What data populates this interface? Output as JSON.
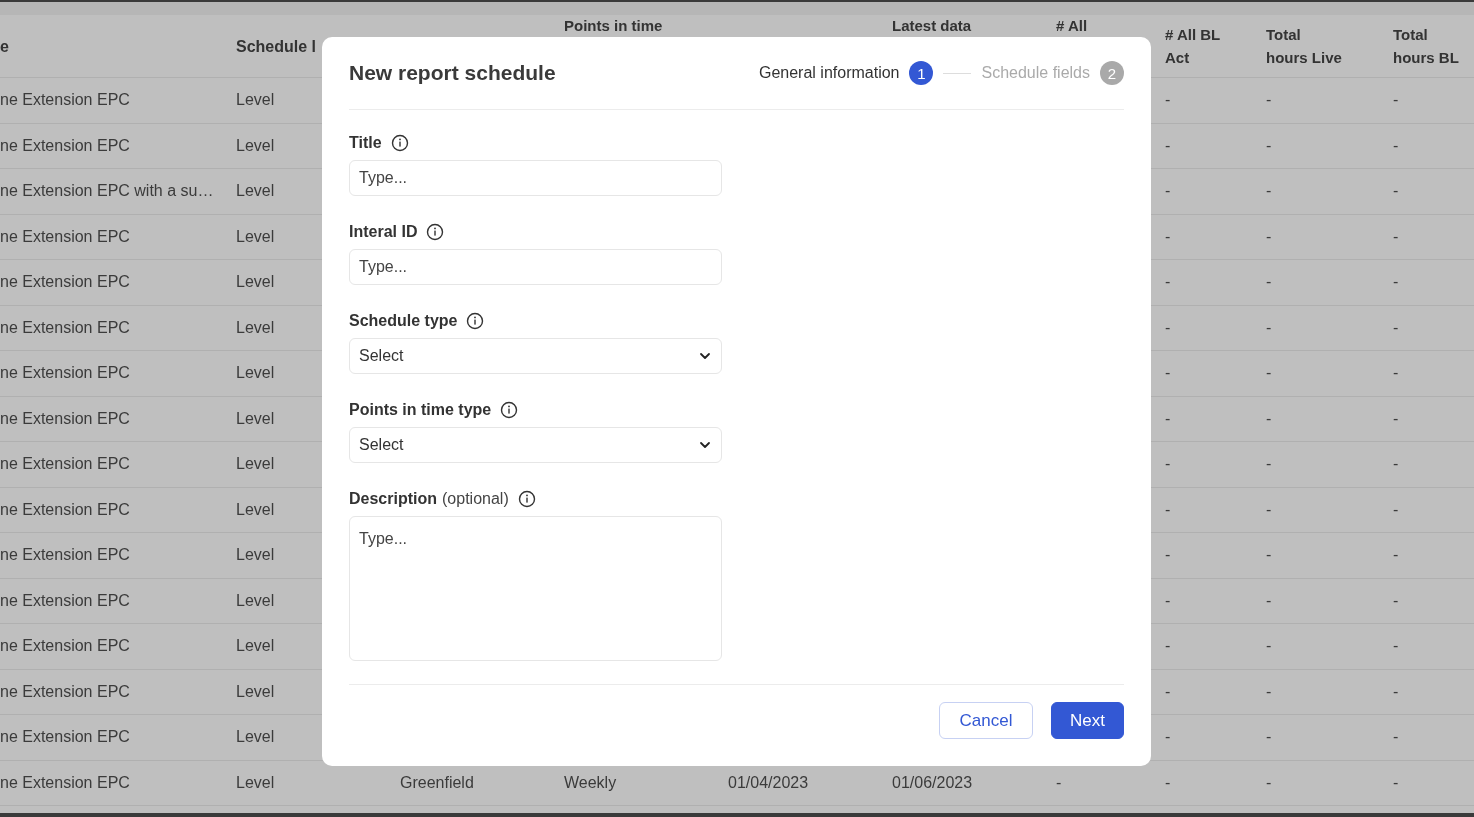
{
  "table": {
    "columns": [
      {
        "label": "e"
      },
      {
        "label": "Schedule l"
      },
      null,
      {
        "label": "Points in time"
      },
      null,
      {
        "label": "Latest data"
      },
      {
        "label": "# All"
      },
      {
        "label": "# All BL Act"
      },
      {
        "label": "Total hours Live"
      },
      {
        "label": "Total hours BL"
      }
    ],
    "rows": [
      {
        "cells": [
          "ne Extension EPC",
          "Level",
          null,
          null,
          null,
          null,
          null,
          "-",
          "-",
          "-"
        ]
      },
      {
        "cells": [
          "ne Extension EPC",
          "Level",
          null,
          null,
          null,
          null,
          null,
          "-",
          "-",
          "-"
        ]
      },
      {
        "cells": [
          "ne Extension EPC with a su…",
          "Level",
          null,
          null,
          null,
          null,
          null,
          "-",
          "-",
          "-"
        ]
      },
      {
        "cells": [
          "ne Extension EPC",
          "Level",
          null,
          null,
          null,
          null,
          null,
          "-",
          "-",
          "-"
        ]
      },
      {
        "cells": [
          "ne Extension EPC",
          "Level",
          null,
          null,
          null,
          null,
          null,
          "-",
          "-",
          "-"
        ]
      },
      {
        "cells": [
          "ne Extension EPC",
          "Level",
          null,
          null,
          null,
          null,
          null,
          "-",
          "-",
          "-"
        ]
      },
      {
        "cells": [
          "ne Extension EPC",
          "Level",
          null,
          null,
          null,
          null,
          null,
          "-",
          "-",
          "-"
        ]
      },
      {
        "cells": [
          "ne Extension EPC",
          "Level",
          null,
          null,
          null,
          null,
          null,
          "-",
          "-",
          "-"
        ]
      },
      {
        "cells": [
          "ne Extension EPC",
          "Level",
          null,
          null,
          null,
          null,
          null,
          "-",
          "-",
          "-"
        ]
      },
      {
        "cells": [
          "ne Extension EPC",
          "Level",
          null,
          null,
          null,
          null,
          null,
          "-",
          "-",
          "-"
        ]
      },
      {
        "cells": [
          "ne Extension EPC",
          "Level",
          null,
          null,
          null,
          null,
          null,
          "-",
          "-",
          "-"
        ]
      },
      {
        "cells": [
          "ne Extension EPC",
          "Level",
          null,
          null,
          null,
          null,
          null,
          "-",
          "-",
          "-"
        ]
      },
      {
        "cells": [
          "ne Extension EPC",
          "Level",
          null,
          null,
          null,
          null,
          null,
          "-",
          "-",
          "-"
        ]
      },
      {
        "cells": [
          "ne Extension EPC",
          "Level",
          null,
          null,
          null,
          null,
          null,
          "-",
          "-",
          "-"
        ]
      },
      {
        "cells": [
          "ne Extension EPC",
          "Level",
          null,
          null,
          null,
          null,
          null,
          "-",
          "-",
          "-"
        ]
      },
      {
        "cells": [
          "ne Extension EPC",
          "Level",
          "Greenfield",
          "Weekly",
          "01/04/2023",
          "01/06/2023",
          "-",
          "-",
          "-",
          "-"
        ]
      }
    ]
  },
  "dialog": {
    "title": "New report schedule",
    "steps": [
      {
        "label": "General information",
        "number": "1",
        "selected": true
      },
      {
        "label": "Schedule fields",
        "number": "2",
        "selected": false
      }
    ],
    "fields": [
      {
        "kind": "text",
        "label": "Title",
        "placeholder": "Type..."
      },
      {
        "kind": "text",
        "label": "Interal ID",
        "placeholder": "Type..."
      },
      {
        "kind": "select",
        "label": "Schedule type",
        "value": "Select"
      },
      {
        "kind": "select",
        "label": "Points in time type",
        "value": "Select"
      },
      {
        "kind": "textarea",
        "label": "Description",
        "note": "(optional)",
        "placeholder": "Type..."
      }
    ],
    "buttons": [
      {
        "label": "Cancel",
        "kind": "secondary"
      },
      {
        "label": "Next",
        "kind": "primary"
      }
    ]
  }
}
